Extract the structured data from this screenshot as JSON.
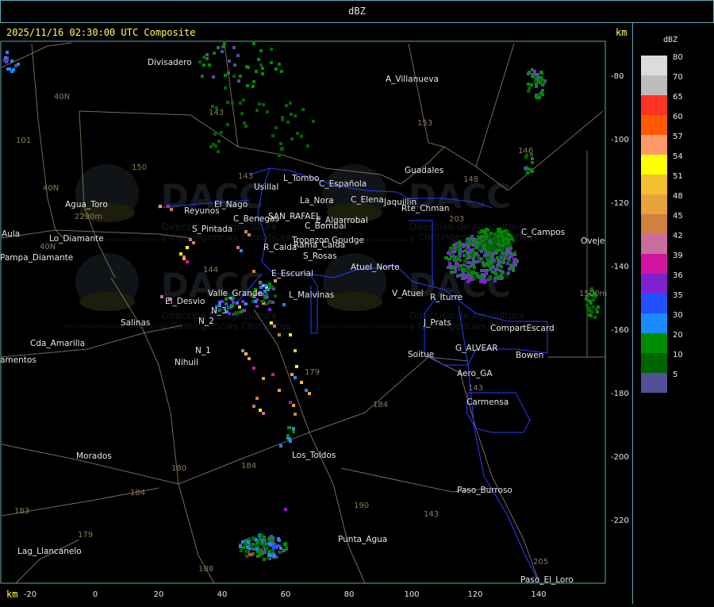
{
  "window": {
    "title": "dBZ"
  },
  "header": {
    "timestamp": "2025/11/16 02:30:00 UTC Composite",
    "unit_top": "km",
    "unit_bottom": "km"
  },
  "x_ticks": [
    "-20",
    "0",
    "20",
    "40",
    "60",
    "80",
    "100",
    "120",
    "140"
  ],
  "y_ticks": [
    "-80",
    "-100",
    "-120",
    "-140",
    "-160",
    "-180",
    "-200",
    "-220"
  ],
  "legend": {
    "title": "dBZ",
    "items": [
      {
        "label": "80",
        "color": "#dcdcdc"
      },
      {
        "label": "70",
        "color": "#bdbdbd"
      },
      {
        "label": "65",
        "color": "#ff3322"
      },
      {
        "label": "60",
        "color": "#ff5a00"
      },
      {
        "label": "57",
        "color": "#ff9966"
      },
      {
        "label": "54",
        "color": "#ffff00"
      },
      {
        "label": "51",
        "color": "#f5c030"
      },
      {
        "label": "48",
        "color": "#e6a33a"
      },
      {
        "label": "45",
        "color": "#d08040"
      },
      {
        "label": "42",
        "color": "#c86e9a"
      },
      {
        "label": "39",
        "color": "#d014a0"
      },
      {
        "label": "36",
        "color": "#8020d0"
      },
      {
        "label": "35",
        "color": "#2050ff"
      },
      {
        "label": "30",
        "color": "#1a8cff"
      },
      {
        "label": "20",
        "color": "#008c00"
      },
      {
        "label": "10",
        "color": "#006400"
      },
      {
        "label": "5",
        "color": "#505096"
      }
    ]
  },
  "watermark": {
    "brand": "DACC",
    "line1": "Dirección de Agricultura",
    "line2": "y Contingencias Climáticas",
    "url": "http://www.contingencias.mendoza.gov.ar"
  },
  "places": [
    "Divisadero",
    "A_Villanueva",
    "Guadales",
    "Usillal",
    "L_Tombo",
    "La_Nora",
    "C_Española",
    "C_Elena",
    "Jaquillin",
    "Rte_Chman",
    "Rama_Caida",
    "Goudge",
    "C_Campos",
    "Oveje",
    "Agua_Toro",
    "Reyunos",
    "El_Nago",
    "S_Pintada",
    "C_Benegas",
    "SAN_RAFAEL",
    "E_Algarrobal",
    "C_Bombal",
    "Tropezon",
    "Pampa_Diamante",
    "Aula",
    "Lo_Diamante",
    "R_Caida",
    "S_Rosas",
    "Atuel_Norte",
    "E_Escurial",
    "V_Atuel",
    "R_Iturre",
    "L_Malvinas",
    "Valle_Grande",
    "El_Desvio",
    "N_3",
    "N_2",
    "N_1",
    "Salinas",
    "Cda_Amarilla",
    "Nihuil",
    "Soitue",
    "J_Prats",
    "CompartEscard",
    "G_ALVEAR",
    "Bowen",
    "Aero_GA",
    "Carmensa",
    "Morados",
    "Los_Toldos",
    "Paso_Burroso",
    "Punta_Agua",
    "Lag_Llancanelo",
    "Paso_El_Loro",
    "amentos"
  ],
  "road_numbers": [
    "143",
    "153",
    "146",
    "148",
    "101",
    "40N",
    "40N",
    "40N",
    "150",
    "143",
    "144",
    "203",
    "179",
    "184",
    "180",
    "184",
    "184",
    "183",
    "179",
    "190",
    "143",
    "143",
    "205",
    "1500m",
    "2290m",
    "188"
  ],
  "colors": {
    "frame": "#5fa8b0",
    "tick_text": "#ffff55",
    "boundary": "#2a3cff",
    "roads": "#7a6a55",
    "place_text": "#e6e6e6"
  }
}
